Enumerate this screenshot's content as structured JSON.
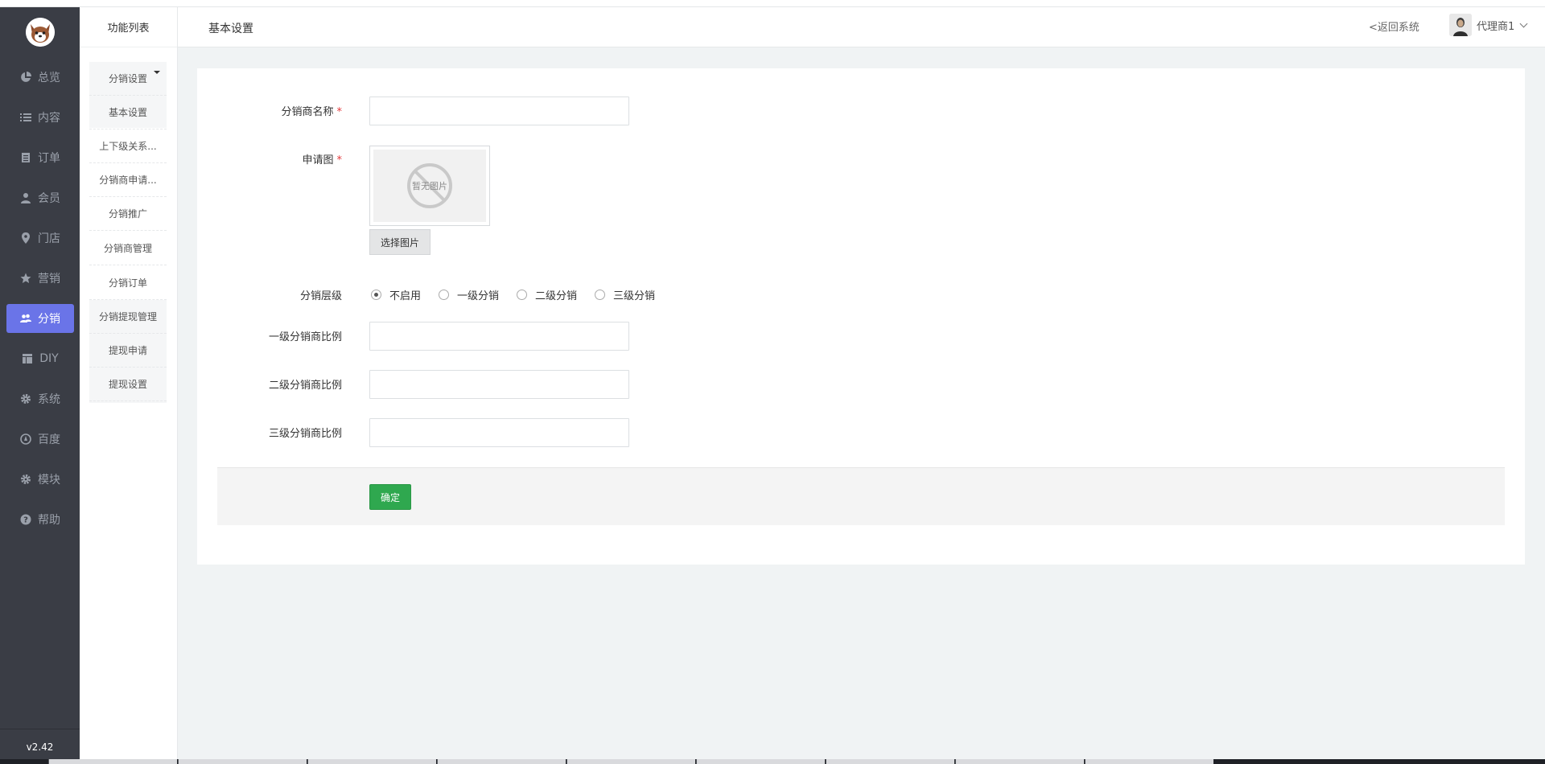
{
  "sidebar": {
    "items": [
      {
        "label": "总览",
        "icon": "pie-chart-icon"
      },
      {
        "label": "内容",
        "icon": "list-icon"
      },
      {
        "label": "订单",
        "icon": "document-icon"
      },
      {
        "label": "会员",
        "icon": "user-icon"
      },
      {
        "label": "门店",
        "icon": "map-pin-icon"
      },
      {
        "label": "营销",
        "icon": "star-icon"
      },
      {
        "label": "分销",
        "icon": "users-icon",
        "active": true
      },
      {
        "label": "DIY",
        "icon": "layout-icon"
      },
      {
        "label": "系统",
        "icon": "gear-icon"
      },
      {
        "label": "百度",
        "icon": "compass-icon"
      },
      {
        "label": "模块",
        "icon": "gear-icon"
      },
      {
        "label": "帮助",
        "icon": "question-icon"
      }
    ],
    "version": "v2.42"
  },
  "subpanel": {
    "title": "功能列表",
    "items": [
      "分销设置",
      "基本设置",
      "上下级关系...",
      "分销商申请...",
      "分销推广",
      "分销商管理",
      "分销订单",
      "分销提现管理",
      "提现申请",
      "提现设置"
    ]
  },
  "header": {
    "page_title": "基本设置",
    "back_link": "<返回系统",
    "user_name": "代理商1"
  },
  "form": {
    "name_label": "分销商名称",
    "name_value": "",
    "image_label": "申请图",
    "image_placeholder": "暂无图片",
    "select_image_button": "选择图片",
    "level_label": "分销层级",
    "level_options": [
      "不启用",
      "一级分销",
      "二级分销",
      "三级分销"
    ],
    "level_selected": "不启用",
    "ratio1_label": "一级分销商比例",
    "ratio1_value": "",
    "ratio2_label": "二级分销商比例",
    "ratio2_value": "",
    "ratio3_label": "三级分销商比例",
    "ratio3_value": "",
    "required_mark": "*",
    "submit_button": "确定"
  },
  "colors": {
    "sidebar_bg": "#3a3d45",
    "active_nav": "#6a74e8",
    "submit_green": "#2fa84f",
    "required_red": "#e4393c"
  }
}
